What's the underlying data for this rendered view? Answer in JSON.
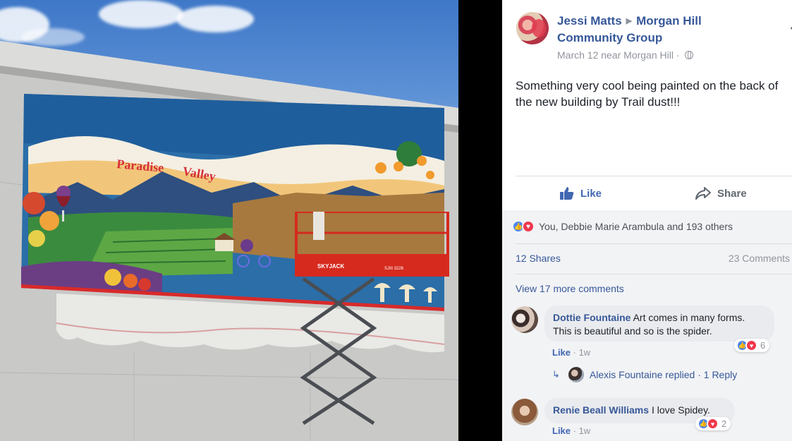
{
  "post": {
    "author": "Jessi Matts",
    "group": "Morgan Hill Community Group",
    "meta": "March 12 near Morgan Hill · ",
    "more": "···",
    "text": "Something very cool being painted on the back of the new building by Trail dust!!!",
    "actions": {
      "like": "Like",
      "share": "Share"
    },
    "reactions": "You, Debbie Marie Arambula and 193 others",
    "shares": "12 Shares",
    "comments_count": "23 Comments",
    "view_more": "View 17 more comments"
  },
  "comments": [
    {
      "author": "Dottie Fountaine",
      "text": "Art comes in many forms. This is beautiful and so is the spider.",
      "like": "Like",
      "time": "1w",
      "reaction_count": "6",
      "reply": {
        "text": "Alexis Fountaine replied · 1 Reply"
      }
    },
    {
      "author": "Renie Beall Williams",
      "text": "I love Spidey.",
      "like": "Like",
      "time": "1w",
      "reaction_count": "2"
    }
  ],
  "mural": {
    "word1": "Paradise",
    "word2": "Valley",
    "lift_label": "SKYJACK",
    "lift_id": "SJIII 3226"
  },
  "colors": {
    "link": "#365899",
    "text": "#1d2129",
    "muted": "#90949c",
    "like_blue": "#4267b2",
    "love_red": "#f0384d"
  },
  "icons": [
    "thumbs-up-icon",
    "share-arrow-icon",
    "globe-icon",
    "like-reaction-icon",
    "love-reaction-icon",
    "reply-arrow-icon"
  ]
}
